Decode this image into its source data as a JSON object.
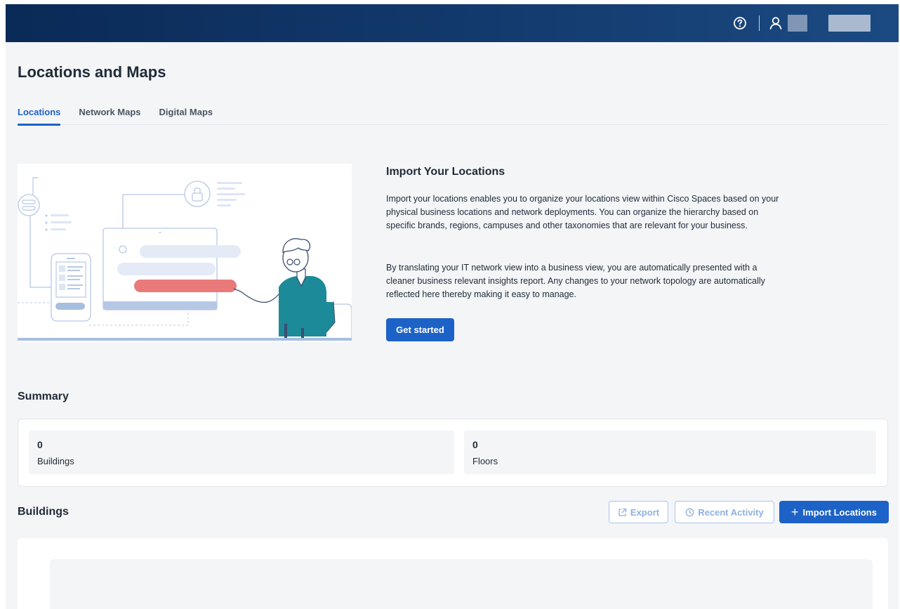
{
  "page": {
    "title": "Locations and Maps"
  },
  "header": {
    "help_icon": "help-circle-icon",
    "user_icon": "user-icon"
  },
  "tabs": [
    {
      "label": "Locations",
      "active": true
    },
    {
      "label": "Network Maps",
      "active": false
    },
    {
      "label": "Digital Maps",
      "active": false
    }
  ],
  "import": {
    "title": "Import Your Locations",
    "paragraph1": "Import your locations enables you to organize your locations view within Cisco Spaces based on your physical business locations and network deployments. You can organize the hierarchy based on specific brands, regions, campuses and other taxonomies that are relevant for your business.",
    "paragraph2": "By translating your IT network view into a business view, you are automatically presented with a cleaner business relevant insights report. Any changes to your network topology are automatically reflected here thereby making it easy to manage.",
    "button_label": "Get started"
  },
  "summary": {
    "title": "Summary",
    "buildings": {
      "value": "0",
      "label": "Buildings"
    },
    "floors": {
      "value": "0",
      "label": "Floors"
    }
  },
  "buildings": {
    "title": "Buildings",
    "export_label": "Export",
    "recent_activity_label": "Recent Activity",
    "import_label": "Import Locations"
  },
  "colors": {
    "primary": "#1d62c6",
    "header_bg": "#0a2a57",
    "accent_red": "#ea7a7a",
    "accent_teal": "#1c8a99"
  }
}
